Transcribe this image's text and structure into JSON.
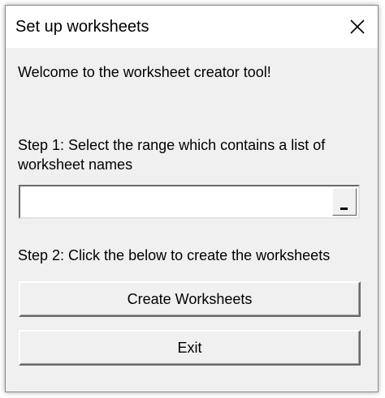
{
  "window": {
    "title": "Set up worksheets",
    "close_icon": "close-icon"
  },
  "content": {
    "welcome_text": "Welcome to the worksheet creator tool!",
    "step1_text": "Step 1: Select the range which contains a list of worksheet names",
    "range_input_value": "",
    "collapse_icon": "collapse-dialog-icon",
    "step2_text": "Step 2: Click the below to create the worksheets",
    "create_button_label": "Create Worksheets",
    "exit_button_label": "Exit"
  },
  "colors": {
    "dialog_background": "#f0f0f0",
    "titlebar_background": "#ffffff",
    "input_background": "#ffffff"
  }
}
